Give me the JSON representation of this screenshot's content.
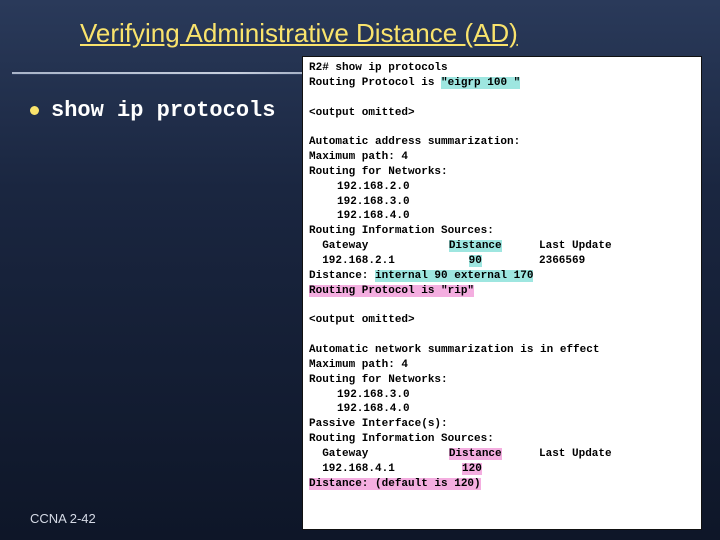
{
  "title": "Verifying Administrative Distance (AD)",
  "bullet": "show ip protocols",
  "footer": "CCNA 2-42",
  "term": {
    "prompt": "R2# show ip protocols",
    "proto_eigrp_pre": "Routing Protocol is ",
    "proto_eigrp_hl": "\"eigrp 100 \"",
    "omitted": "<output omitted>",
    "autoaddr": "Automatic address summarization:",
    "maxpath": "Maximum path: 4",
    "routing_for": "Routing for Networks:",
    "net_a1": "192.168.2.0",
    "net_a2": "192.168.3.0",
    "net_a3": "192.168.4.0",
    "ris": "Routing Information Sources:",
    "hdr_gateway": "Gateway",
    "hdr_distance": "Distance",
    "hdr_lastupdate": "Last Update",
    "row_a_gw": "192.168.2.1",
    "row_a_dist": "90",
    "row_a_last": "2366569",
    "dist_line_pre": "Distance: ",
    "dist_line_hl": "internal 90 external 170",
    "proto_rip_pre": "Routing Protocol is ",
    "proto_rip_hl": "\"rip\"",
    "autonet": "Automatic network summarization is in effect",
    "net_b1": "192.168.3.0",
    "net_b2": "192.168.4.0",
    "passive": "Passive Interface(s):",
    "row_b_gw": "192.168.4.1",
    "row_b_dist": "120",
    "dist_default_hl": "Distance: (default is 120)"
  }
}
